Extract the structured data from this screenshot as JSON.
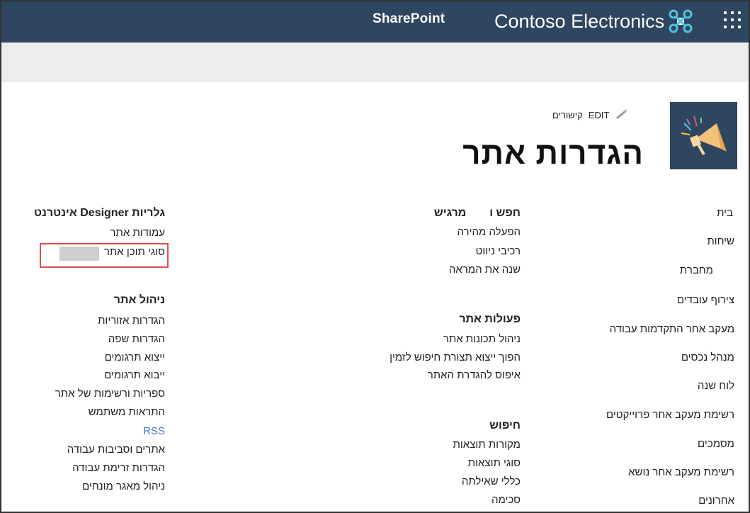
{
  "suite": {
    "brand_name": "Contoso Electronics",
    "product_name": "SharePoint",
    "waffle_icon": "app-launcher-icon",
    "brand_icon": "drone-icon",
    "colors": {
      "suitebar": "#2f4660",
      "ribbon": "#ededed",
      "accent": "#4fc3e0"
    }
  },
  "title_area": {
    "links_label": "קישורים",
    "edit_label": "EDIT",
    "page_title": "הגדרות אתר",
    "logo_icon": "megaphone-icon"
  },
  "quick_launch": [
    "בית",
    "שיחות",
    "מחברת",
    "צירוף עובדים",
    "מעקב אחר התקדמות עבודה",
    "מנהל נכסים",
    "לוח שנה",
    "רשימת מעקב אחר פרוייקטים",
    "מסמכים",
    "רשימת מעקב אחר נושא",
    "אחרונים"
  ],
  "columns": {
    "look_feel": {
      "title_part1": "חפש ו",
      "title_part2": "מרגיש",
      "links": [
        "הפעלה מהירה",
        "רכיבי ניווט",
        "שנה את המראה"
      ]
    },
    "site_actions": {
      "title": "פעולות אתר",
      "links": [
        "ניהול תכונות אתר",
        "הפוך ייצוא תצורת חיפוש לזמין",
        "איפוס להגדרת האתר"
      ]
    },
    "search": {
      "title": "חיפוש",
      "links": [
        "מקורות תוצאות",
        "סוגי תוצאות",
        "כללי שאילתה",
        "סכימה"
      ]
    },
    "designer_galleries": {
      "title": "גלריות Designer אינטרנט",
      "links": [
        "עמודות אתר",
        "סוגי תוכן אתר"
      ]
    },
    "site_admin": {
      "title": "ניהול אתר",
      "links": [
        "הגדרות אזוריות",
        "הגדרות שפה",
        "ייצוא תרגומים",
        "ייבוא תרגומים",
        "ספריות ורשימות של אתר",
        "התראות משתמש",
        "RSS",
        "אתרים וסביבות עבודה",
        "הגדרות זרימת עבודה",
        "ניהול מאגר מונחים"
      ]
    }
  },
  "highlight_color": "#e14d4d"
}
